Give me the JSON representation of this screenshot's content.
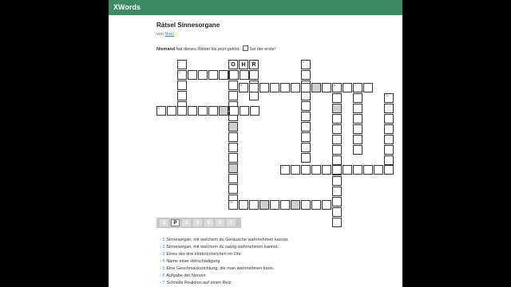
{
  "app": {
    "brand": "XWords"
  },
  "puzzle": {
    "title": "Rätsel Sinnesorgane",
    "by_prefix": "von",
    "author": "Noel",
    "status_name": "Niemand",
    "status_text": "hat dieses Rätsel bis jetzt gelöst.",
    "status_link": "Sei der erste!"
  },
  "clue_numbers": [
    "1",
    "2",
    "3",
    "4",
    "5",
    "6",
    "7",
    "8",
    "9",
    "10",
    "11",
    "12",
    "13"
  ],
  "filled_letters": [
    "O",
    "H",
    "R"
  ],
  "letter_bar": [
    "1",
    "P",
    "3",
    "4",
    "5",
    "6",
    "7"
  ],
  "clues": [
    {
      "num": "1",
      "text": "Sinnesorgan, mit welchem du Geräusche wahrnehmen kannst."
    },
    {
      "num": "2",
      "text": "Sinnesorgan, mit welchem du salzig wahrnehmen kannst."
    },
    {
      "num": "3",
      "text": "Eines der drei Hörknöchelchen im Ohr."
    },
    {
      "num": "4",
      "text": "Name einer Hörschädigung"
    },
    {
      "num": "5",
      "text": "Eine Geschmacksrichtung, die man wahrnehmen kann."
    },
    {
      "num": "6",
      "text": "Aufgabe der Nerven"
    },
    {
      "num": "7",
      "text": "Schnelle Reaktion auf einen Reiz"
    }
  ]
}
